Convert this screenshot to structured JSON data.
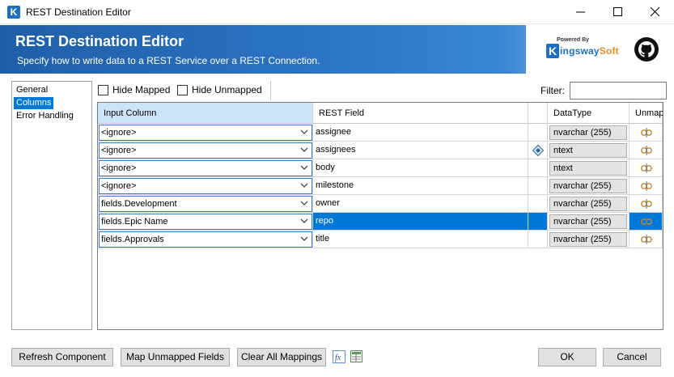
{
  "window": {
    "title": "REST Destination Editor",
    "app_icon_letter": "K"
  },
  "banner": {
    "title": "REST Destination Editor",
    "subtitle": "Specify how to write data to a REST Service over a REST Connection.",
    "logo_powered": "Powered By",
    "logo_k": "K",
    "logo_word_main": "ingsway",
    "logo_word_soft": "Soft"
  },
  "nav": {
    "items": [
      {
        "label": "General",
        "selected": false
      },
      {
        "label": "Columns",
        "selected": true
      },
      {
        "label": "Error Handling",
        "selected": false
      }
    ]
  },
  "toolbar": {
    "hide_mapped": "Hide Mapped",
    "hide_unmapped": "Hide Unmapped",
    "filter_label": "Filter:",
    "filter_value": ""
  },
  "grid": {
    "headers": {
      "input_column": "Input Column",
      "rest_field": "REST Field",
      "data_type": "DataType",
      "unmap": "Unmap"
    },
    "rows": [
      {
        "input": "<ignore>",
        "field": "assignee",
        "type": "nvarchar (255)",
        "key": false,
        "selected": false
      },
      {
        "input": "<ignore>",
        "field": "assignees",
        "type": "ntext",
        "key": true,
        "selected": false
      },
      {
        "input": "<ignore>",
        "field": "body",
        "type": "ntext",
        "key": false,
        "selected": false
      },
      {
        "input": "<ignore>",
        "field": "milestone",
        "type": "nvarchar (255)",
        "key": false,
        "selected": false
      },
      {
        "input": "fields.Development",
        "field": "owner",
        "type": "nvarchar (255)",
        "key": false,
        "selected": false
      },
      {
        "input": "fields.Epic Name",
        "field": "repo",
        "type": "nvarchar (255)",
        "key": false,
        "selected": true
      },
      {
        "input": "fields.Approvals",
        "field": "title",
        "type": "nvarchar (255)",
        "key": false,
        "selected": false
      }
    ]
  },
  "footer": {
    "refresh": "Refresh Component",
    "map_unmapped": "Map Unmapped Fields",
    "clear_all": "Clear All Mappings",
    "ok": "OK",
    "cancel": "Cancel"
  },
  "colors": {
    "accent": "#0078d7",
    "banner_dark": "#1f5ea8",
    "header_active": "#cce4f7"
  }
}
